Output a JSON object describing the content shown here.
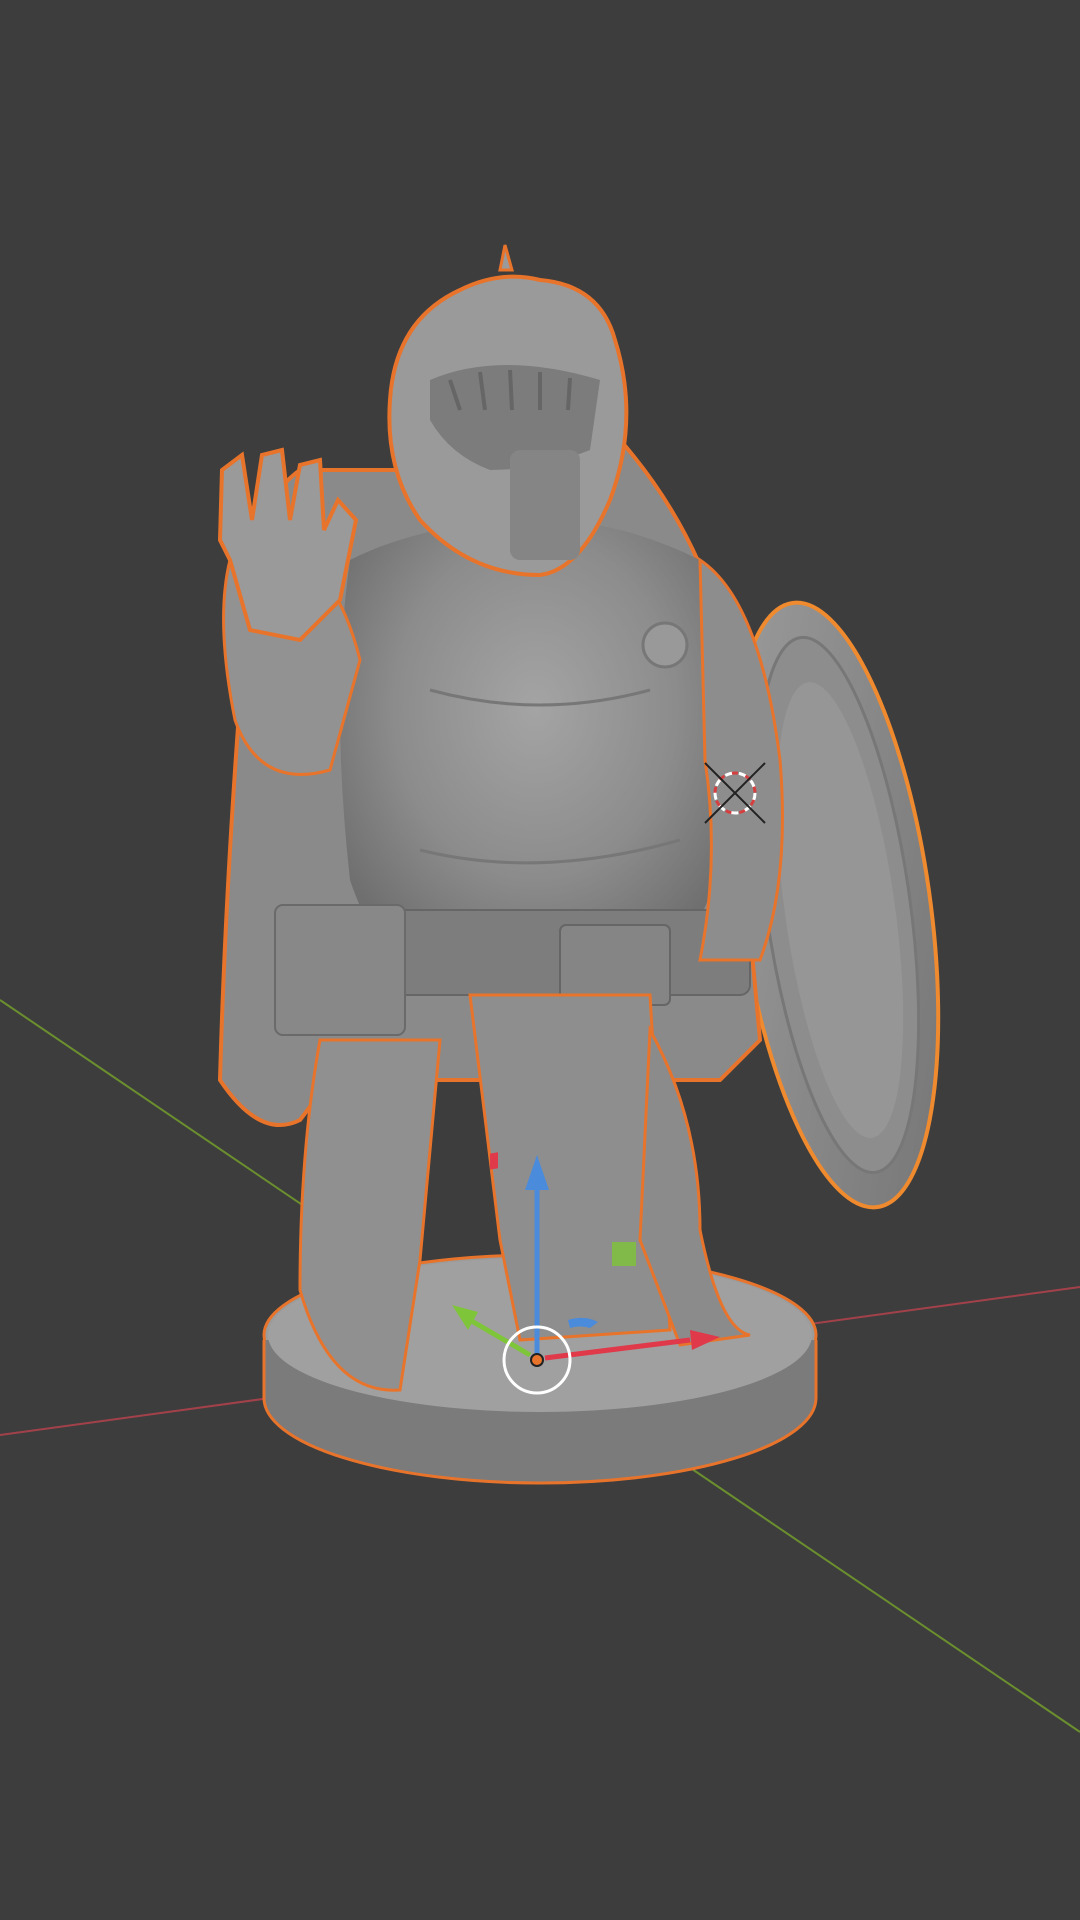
{
  "viewport": {
    "mode": "3D Viewport",
    "shading": "solid",
    "background_color": "#3d3d3d"
  },
  "axes": {
    "x_axis_color": "#a3414a",
    "y_axis_color": "#6b8f2e"
  },
  "selection": {
    "outline_active_color": "#e8742c",
    "outline_selected_color": "#f08a2e",
    "objects": [
      {
        "name": "miniature-figure",
        "state": "active"
      },
      {
        "name": "shield",
        "state": "selected"
      }
    ]
  },
  "gizmo": {
    "type": "transform",
    "z_color": "#4a8bdc",
    "y_color": "#7fc53a",
    "x_color": "#e0394a",
    "pivot_color": "#e8742c"
  },
  "cursor_3d": {
    "icon": "crosshair-ring"
  },
  "model": {
    "base_color": "#8a8a8a"
  }
}
